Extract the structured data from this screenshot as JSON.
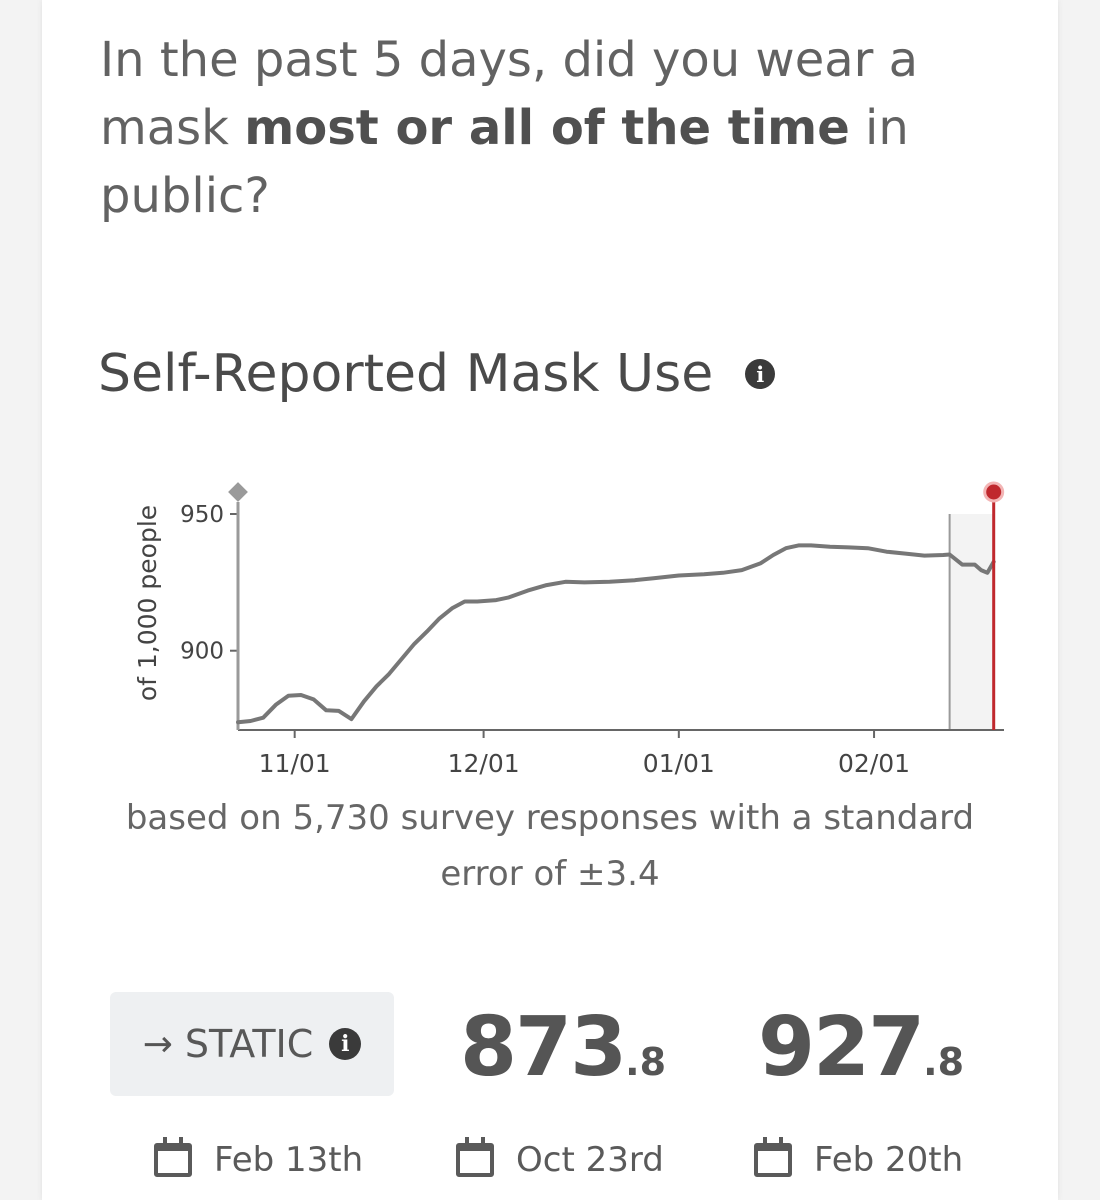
{
  "question": {
    "prefix": "In the past 5 days, did you wear a mask ",
    "emphasis": "most or all of the time",
    "suffix": " in public?"
  },
  "chart_title": "Self-Reported Mask Use",
  "info_icon": "info-circle-icon",
  "chart_data": {
    "type": "line",
    "title": "Self-Reported Mask Use",
    "ylabel": "of 1,000 people",
    "xlabel": "",
    "yticks": [
      900,
      950
    ],
    "xticks": [
      "11/01",
      "12/01",
      "01/01",
      "02/01"
    ],
    "xtick_dates": [
      "2020-11-01",
      "2020-12-01",
      "2021-01-01",
      "2021-02-01"
    ],
    "ylim": [
      871,
      950
    ],
    "xlim": [
      "2020-10-23",
      "2021-02-21"
    ],
    "highlight_range": [
      "2021-02-13",
      "2021-02-20"
    ],
    "marker_start": "2020-10-23",
    "marker_end": "2021-02-20",
    "colors": {
      "line": "#777777",
      "marker_end": "#c0282d",
      "marker_start": "#9a9a9a",
      "band": "#f3f3f3"
    },
    "series": [
      {
        "x": [
          "2020-10-23",
          "2020-10-25",
          "2020-10-27",
          "2020-10-29",
          "2020-10-31",
          "2020-11-02",
          "2020-11-04",
          "2020-11-06",
          "2020-11-08",
          "2020-11-10",
          "2020-11-12",
          "2020-11-14",
          "2020-11-16",
          "2020-11-18",
          "2020-11-20",
          "2020-11-22",
          "2020-11-24",
          "2020-11-26",
          "2020-11-28",
          "2020-11-30",
          "2020-12-03",
          "2020-12-05",
          "2020-12-08",
          "2020-12-11",
          "2020-12-14",
          "2020-12-17",
          "2020-12-21",
          "2020-12-25",
          "2020-12-28",
          "2021-01-01",
          "2021-01-05",
          "2021-01-08",
          "2021-01-11",
          "2021-01-14",
          "2021-01-16",
          "2021-01-18",
          "2021-01-20",
          "2021-01-22",
          "2021-01-25",
          "2021-01-28",
          "2021-01-31",
          "2021-02-03",
          "2021-02-06",
          "2021-02-09",
          "2021-02-12",
          "2021-02-13",
          "2021-02-15",
          "2021-02-17",
          "2021-02-18",
          "2021-02-19",
          "2021-02-20"
        ],
        "y": [
          873.8,
          874.3,
          875.5,
          880.2,
          883.5,
          883.8,
          882.2,
          878.2,
          878.0,
          875.0,
          881.5,
          887.0,
          891.5,
          897.0,
          902.5,
          907.0,
          911.8,
          915.5,
          918.0,
          918.0,
          918.5,
          919.5,
          922.0,
          924.0,
          925.2,
          925.0,
          925.2,
          925.8,
          926.5,
          927.5,
          928.0,
          928.5,
          929.5,
          932.0,
          935.0,
          937.5,
          938.5,
          938.5,
          938.0,
          937.8,
          937.5,
          936.2,
          935.5,
          934.8,
          935.0,
          935.2,
          931.5,
          931.5,
          929.5,
          928.5,
          932.5
        ]
      }
    ]
  },
  "caption": "based on 5,730 survey responses with a standard error of ±3.4",
  "static_badge": {
    "arrow": "→",
    "label": "STATIC",
    "arrow_icon": "arrow-right-icon"
  },
  "stats": [
    {
      "whole": "873",
      "decimal": ".8",
      "date": "Oct 23rd"
    },
    {
      "whole": "927",
      "decimal": ".8",
      "date": "Feb 20th"
    }
  ],
  "badge_date": "Feb 13th",
  "calendar_icon": "calendar-icon"
}
